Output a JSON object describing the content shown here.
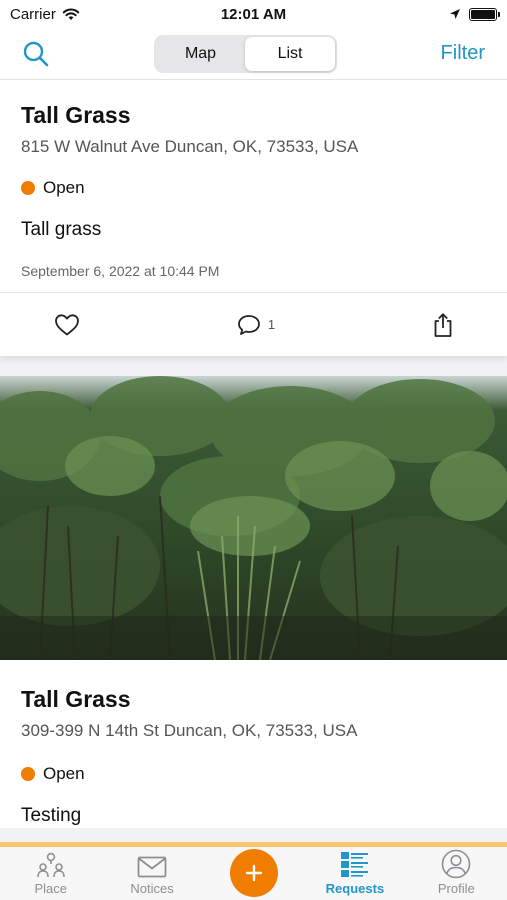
{
  "status_bar": {
    "carrier": "Carrier",
    "time": "12:01 AM"
  },
  "nav": {
    "segments": [
      "Map",
      "List"
    ],
    "active_segment": "List",
    "filter_label": "Filter",
    "accent_color": "#2196c8"
  },
  "feed": {
    "items": [
      {
        "title": "Tall Grass",
        "address": "815 W Walnut Ave Duncan, OK, 73533, USA",
        "status": "Open",
        "status_color": "#f07d00",
        "description": "Tall grass",
        "date": "September 6, 2022 at 10:44 PM",
        "comment_count": "1",
        "icons": [
          "heart-icon",
          "comment-icon",
          "share-icon"
        ]
      },
      {
        "title": "Tall Grass",
        "address": "309-399 N 14th St Duncan, OK, 73533, USA",
        "status": "Open",
        "status_color": "#f07d00",
        "description": "Testing",
        "photo": "overgrown-vegetation-photo"
      }
    ]
  },
  "tab_bar": {
    "tabs": [
      {
        "label": "Place",
        "icon": "place-icon"
      },
      {
        "label": "Notices",
        "icon": "mail-icon"
      },
      {
        "label": "",
        "icon": "plus-icon"
      },
      {
        "label": "Requests",
        "icon": "list-icon"
      },
      {
        "label": "Profile",
        "icon": "profile-icon"
      }
    ],
    "active_tab": "Requests",
    "fab_color": "#f07d00"
  }
}
